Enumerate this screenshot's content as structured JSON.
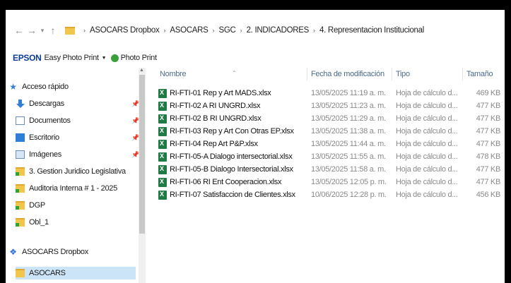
{
  "address_bar": {
    "back_icon": "arrow-left",
    "forward_icon": "arrow-right",
    "recent_icon": "chevron-down",
    "up_icon": "arrow-up",
    "breadcrumbs": [
      "ASOCARS Dropbox",
      "ASOCARS",
      "SGC",
      "2. INDICADORES",
      "4. Representacion Institucional"
    ]
  },
  "toolbar": {
    "brand": "EPSON",
    "app": "Easy Photo Print",
    "photo_print": "Photo Print"
  },
  "sidebar": {
    "quick_access": "Acceso rápido",
    "items": [
      {
        "label": "Descargas",
        "icon": "download-icon",
        "pinned": true
      },
      {
        "label": "Documentos",
        "icon": "document-icon",
        "pinned": true
      },
      {
        "label": "Escritorio",
        "icon": "desktop-icon",
        "pinned": true
      },
      {
        "label": "Imágenes",
        "icon": "images-icon",
        "pinned": true
      },
      {
        "label": "3. Gestion Juridico Legislativa",
        "icon": "folder-icon",
        "pinned": false
      },
      {
        "label": "Auditoria Interna # 1 - 2025",
        "icon": "folder-icon",
        "pinned": false
      },
      {
        "label": "DGP",
        "icon": "folder-icon",
        "pinned": false
      },
      {
        "label": "Obl_1",
        "icon": "folder-icon",
        "pinned": false
      }
    ],
    "dropbox": "ASOCARS Dropbox",
    "dropbox_child": "ASOCARS"
  },
  "columns": {
    "name": "Nombre",
    "date": "Fecha de modificación",
    "type": "Tipo",
    "size": "Tamaño"
  },
  "files": [
    {
      "name": "RI-FTI-01 Rep y Art MADS.xlsx",
      "date": "13/05/2025 11:19 a. m.",
      "type": "Hoja de cálculo d...",
      "size": "469 KB"
    },
    {
      "name": "RI-FTI-02 A RI UNGRD.xlsx",
      "date": "13/05/2025 11:23 a. m.",
      "type": "Hoja de cálculo d...",
      "size": "477 KB"
    },
    {
      "name": "RI-FTI-02 B RI UNGRD.xlsx",
      "date": "13/05/2025 11:29 a. m.",
      "type": "Hoja de cálculo d...",
      "size": "477 KB"
    },
    {
      "name": "RI-FTI-03  Rep y Art Con Otras EP.xlsx",
      "date": "13/05/2025 11:38 a. m.",
      "type": "Hoja de cálculo d...",
      "size": "477 KB"
    },
    {
      "name": "RI-FTI-04 Rep Art P&P.xlsx",
      "date": "13/05/2025 11:44 a. m.",
      "type": "Hoja de cálculo d...",
      "size": "477 KB"
    },
    {
      "name": "RI-FTI-05-A Dialogo intersectorial.xlsx",
      "date": "13/05/2025 11:55 a. m.",
      "type": "Hoja de cálculo d...",
      "size": "478 KB"
    },
    {
      "name": "RI-FTI-05-B Dialogo Intersectorial.xlsx",
      "date": "13/05/2025 11:58 a. m.",
      "type": "Hoja de cálculo d...",
      "size": "477 KB"
    },
    {
      "name": "RI-FTI-06 RI Ent Cooperacion.xlsx",
      "date": "13/05/2025 12:05 p. m.",
      "type": "Hoja de cálculo d...",
      "size": "477 KB"
    },
    {
      "name": "RI-FTI-07 Satisfaccion de Clientes.xlsx",
      "date": "10/06/2025 12:28 p. m.",
      "type": "Hoja de cálculo d...",
      "size": "456 KB"
    }
  ]
}
